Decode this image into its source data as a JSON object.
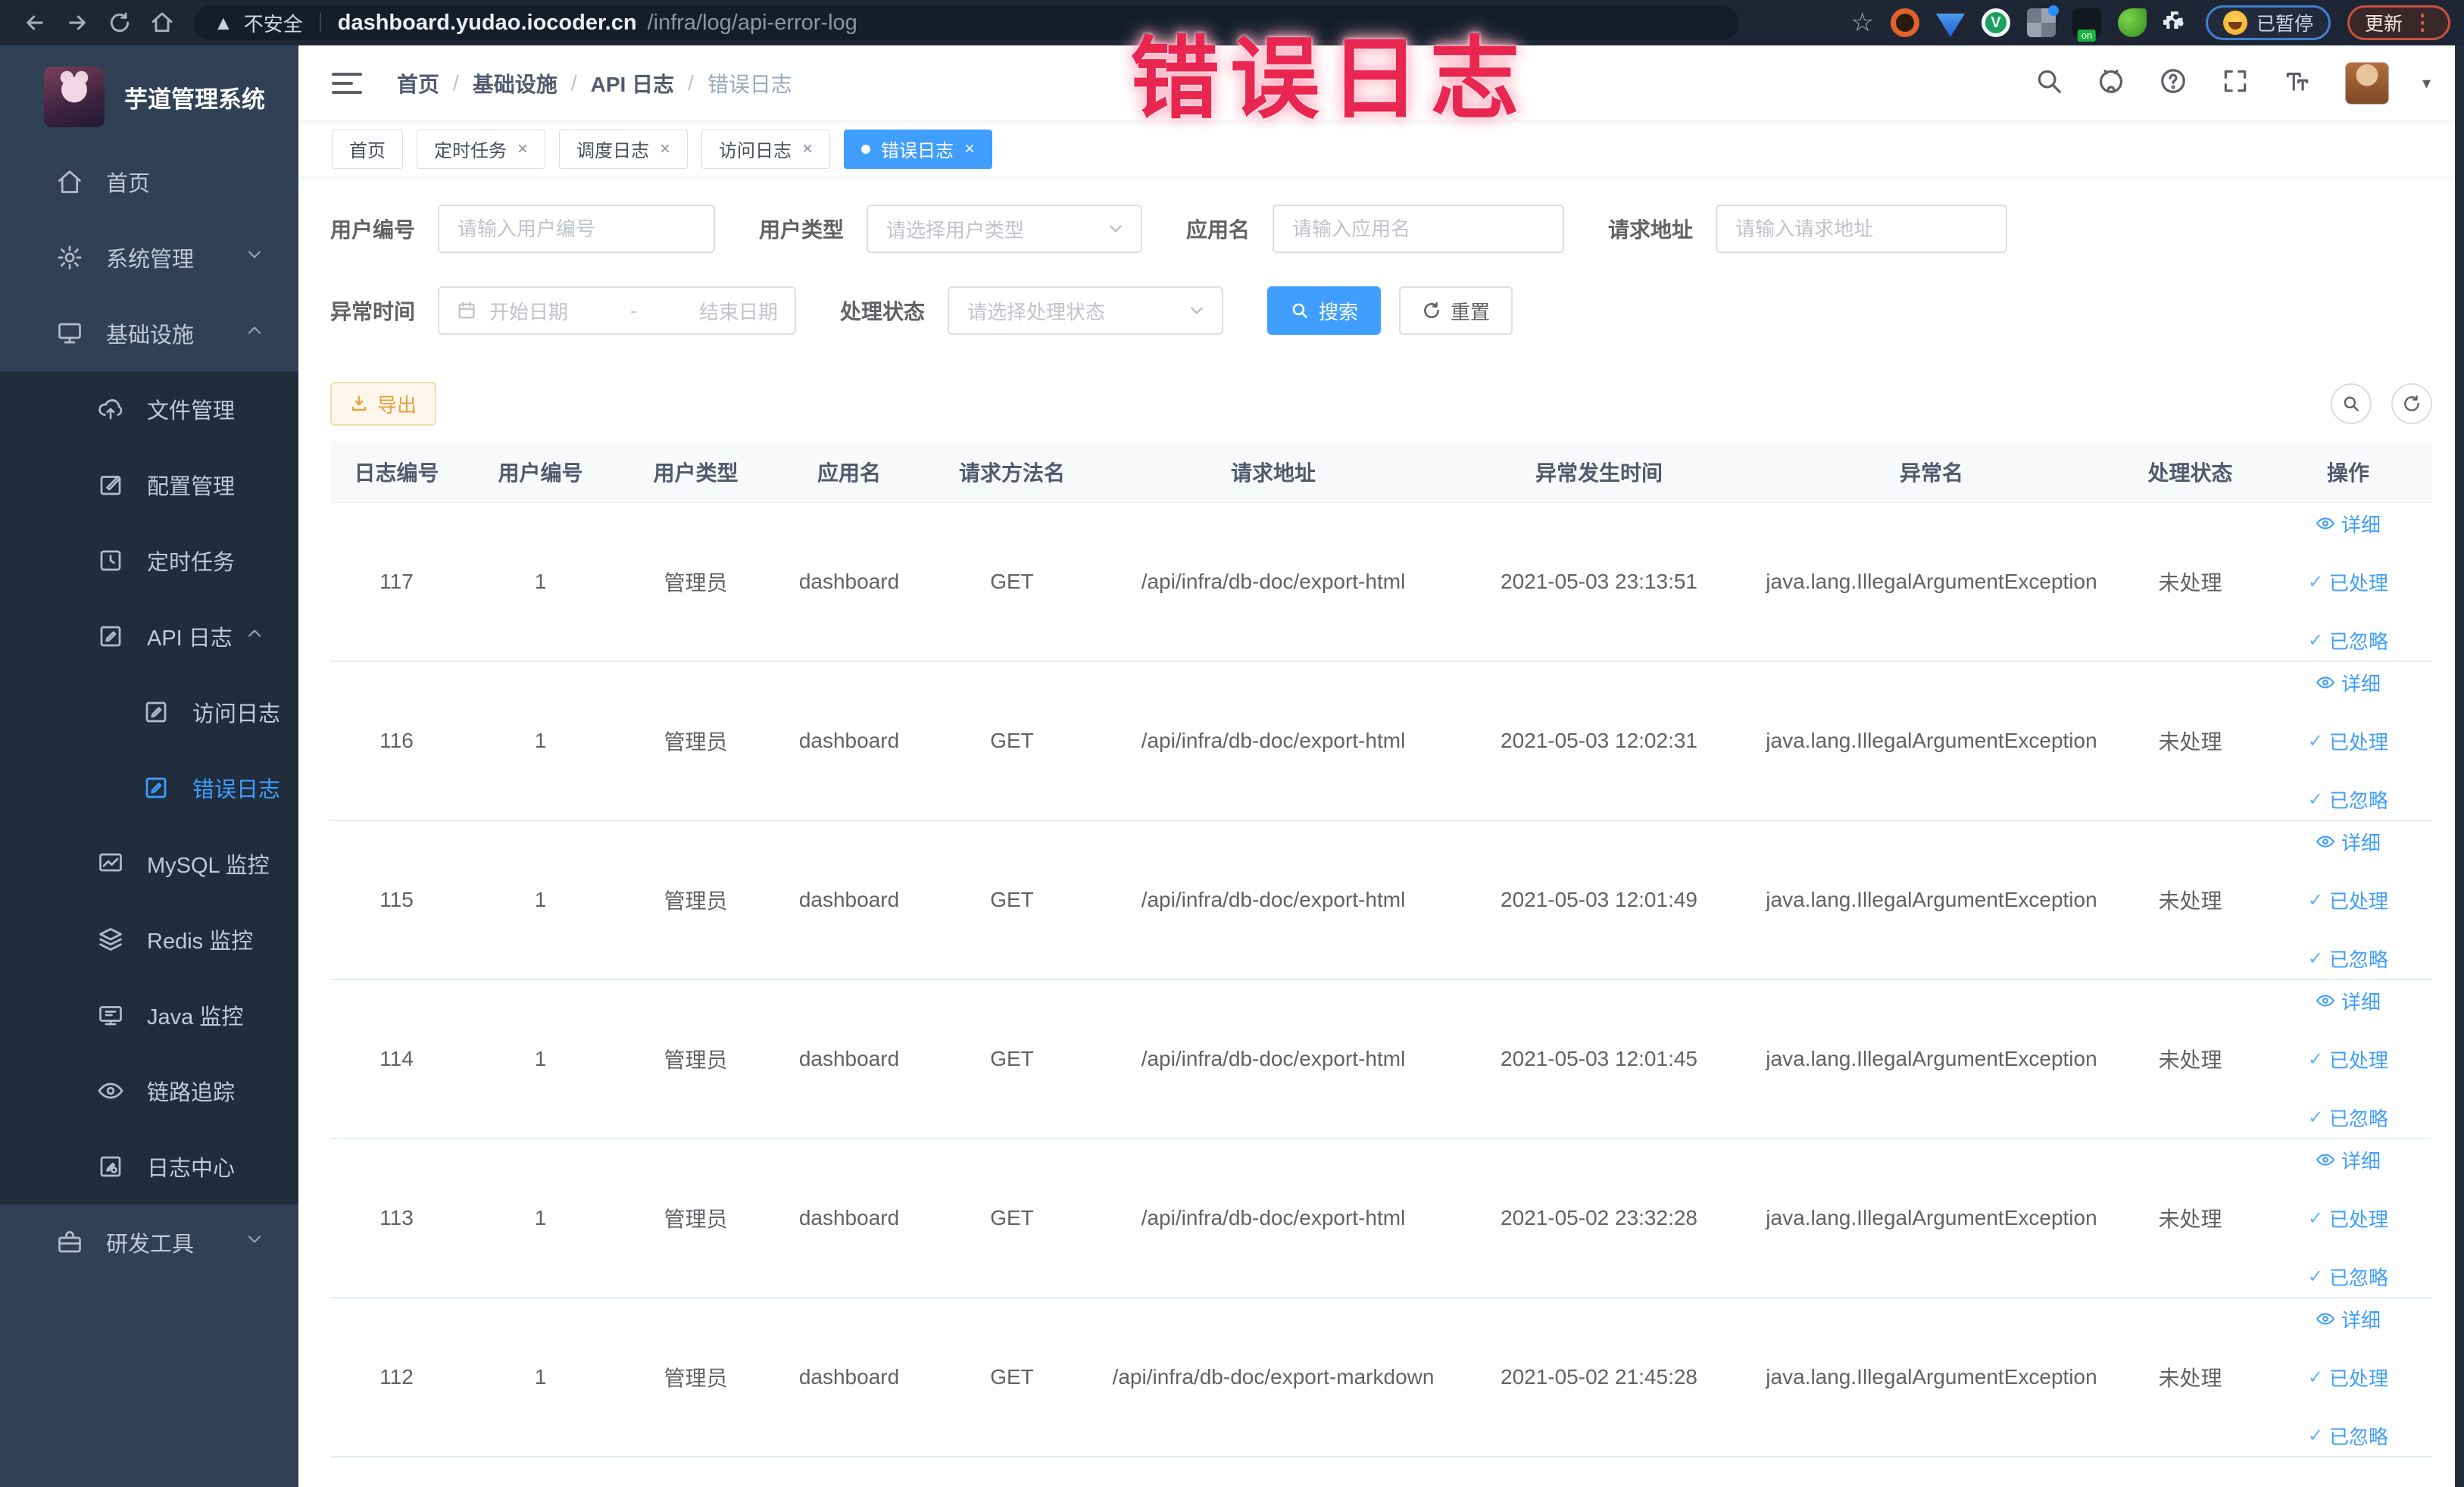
{
  "browser": {
    "security_label": "不安全",
    "url_host": "dashboard.yudao.iocoder.cn",
    "url_path": "/infra/log/api-error-log",
    "paused_label": "已暂停",
    "update_label": "更新"
  },
  "overlay": {
    "text": "错误日志"
  },
  "sidebar": {
    "app_title": "芋道管理系统",
    "items": [
      {
        "label": "首页",
        "active": false
      },
      {
        "label": "系统管理",
        "expanded": false
      },
      {
        "label": "基础设施",
        "expanded": true
      },
      {
        "label": "文件管理"
      },
      {
        "label": "配置管理"
      },
      {
        "label": "定时任务"
      },
      {
        "label": "API 日志",
        "expanded": true
      },
      {
        "label": "访问日志"
      },
      {
        "label": "错误日志",
        "active": true
      },
      {
        "label": "MySQL 监控"
      },
      {
        "label": "Redis 监控"
      },
      {
        "label": "Java 监控"
      },
      {
        "label": "链路追踪"
      },
      {
        "label": "日志中心"
      },
      {
        "label": "研发工具",
        "expanded": false
      }
    ]
  },
  "header": {
    "breadcrumb": [
      "首页",
      "基础设施",
      "API 日志",
      "错误日志"
    ],
    "separator": "/"
  },
  "tabs": [
    {
      "label": "首页",
      "closable": false,
      "active": false
    },
    {
      "label": "定时任务",
      "closable": true,
      "active": false
    },
    {
      "label": "调度日志",
      "closable": true,
      "active": false
    },
    {
      "label": "访问日志",
      "closable": true,
      "active": false
    },
    {
      "label": "错误日志",
      "closable": true,
      "active": true
    }
  ],
  "filters": {
    "user_id": {
      "label": "用户编号",
      "placeholder": "请输入用户编号"
    },
    "user_type": {
      "label": "用户类型",
      "placeholder": "请选择用户类型"
    },
    "app_name": {
      "label": "应用名",
      "placeholder": "请输入应用名"
    },
    "request_url": {
      "label": "请求地址",
      "placeholder": "请输入请求地址"
    },
    "exception_time": {
      "label": "异常时间",
      "start_placeholder": "开始日期",
      "end_placeholder": "结束日期",
      "separator": "-"
    },
    "process_status": {
      "label": "处理状态",
      "placeholder": "请选择处理状态"
    },
    "search_label": "搜索",
    "reset_label": "重置"
  },
  "toolbar": {
    "export_label": "导出"
  },
  "table": {
    "headers": [
      "日志编号",
      "用户编号",
      "用户类型",
      "应用名",
      "请求方法名",
      "请求地址",
      "异常发生时间",
      "异常名",
      "处理状态",
      "操作"
    ],
    "rows": [
      {
        "log_id": "117",
        "user_id": "1",
        "user_type": "管理员",
        "app_name": "dashboard",
        "method": "GET",
        "url": "/api/infra/db-doc/export-html",
        "time": "2021-05-03 23:13:51",
        "exception": "java.lang.IllegalArgumentException",
        "status": "未处理"
      },
      {
        "log_id": "116",
        "user_id": "1",
        "user_type": "管理员",
        "app_name": "dashboard",
        "method": "GET",
        "url": "/api/infra/db-doc/export-html",
        "time": "2021-05-03 12:02:31",
        "exception": "java.lang.IllegalArgumentException",
        "status": "未处理"
      },
      {
        "log_id": "115",
        "user_id": "1",
        "user_type": "管理员",
        "app_name": "dashboard",
        "method": "GET",
        "url": "/api/infra/db-doc/export-html",
        "time": "2021-05-03 12:01:49",
        "exception": "java.lang.IllegalArgumentException",
        "status": "未处理"
      },
      {
        "log_id": "114",
        "user_id": "1",
        "user_type": "管理员",
        "app_name": "dashboard",
        "method": "GET",
        "url": "/api/infra/db-doc/export-html",
        "time": "2021-05-03 12:01:45",
        "exception": "java.lang.IllegalArgumentException",
        "status": "未处理"
      },
      {
        "log_id": "113",
        "user_id": "1",
        "user_type": "管理员",
        "app_name": "dashboard",
        "method": "GET",
        "url": "/api/infra/db-doc/export-html",
        "time": "2021-05-02 23:32:28",
        "exception": "java.lang.IllegalArgumentException",
        "status": "未处理"
      },
      {
        "log_id": "112",
        "user_id": "1",
        "user_type": "管理员",
        "app_name": "dashboard",
        "method": "GET",
        "url": "/api/infra/db-doc/export-markdown",
        "time": "2021-05-02 21:45:28",
        "exception": "java.lang.IllegalArgumentException",
        "status": "未处理"
      }
    ],
    "actions": {
      "detail": "详细",
      "processed": "已处理",
      "ignored": "已忽略"
    }
  },
  "colors": {
    "accent": "#409eff",
    "warning": "#e6a23c",
    "overlay_red": "#e9264f",
    "sidebar_bg": "#304156",
    "submenu_bg": "#1f2d3d"
  }
}
